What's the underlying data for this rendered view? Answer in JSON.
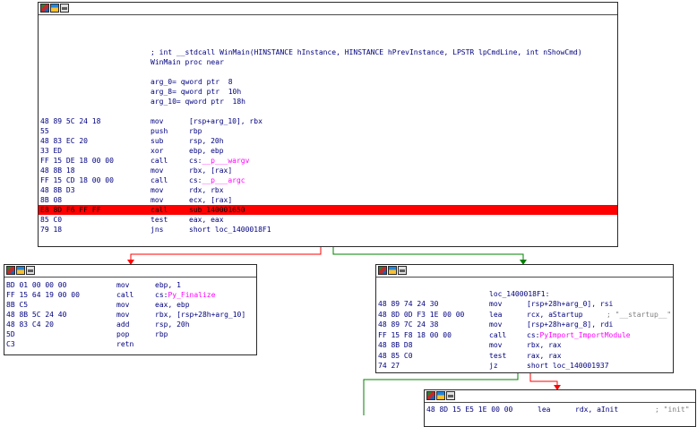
{
  "colors": {
    "text": "#00007f",
    "import_name": "#ff00ff",
    "comment": "#7f7f7f",
    "highlight": "#ff0000",
    "edge_false": "#ff0000",
    "edge_true": "#008000",
    "edge_flow": "#008000"
  },
  "icons": [
    "graph-color-icon",
    "graph-image-icon",
    "graph-window-icon"
  ],
  "nodes": [
    {
      "id": "winmain",
      "header": [
        "; int __stdcall WinMain(HINSTANCE hInstance, HINSTANCE hPrevInstance, LPSTR lpCmdLine, int nShowCmd)",
        "WinMain proc near",
        "",
        "arg_0= qword ptr  8",
        "arg_8= qword ptr  10h",
        "arg_10= qword ptr  18h",
        ""
      ],
      "rows": [
        {
          "bytes": "48 89 5C 24 18",
          "mnem": "mov",
          "ops": "[rsp+arg_10], rbx"
        },
        {
          "bytes": "55",
          "mnem": "push",
          "ops": "rbp"
        },
        {
          "bytes": "48 83 EC 20",
          "mnem": "sub",
          "ops": "rsp, 20h"
        },
        {
          "bytes": "33 ED",
          "mnem": "xor",
          "ops": "ebp, ebp"
        },
        {
          "bytes": "FF 15 DE 18 00 00",
          "mnem": "call",
          "ops": "cs:",
          "imp": "__p___wargv"
        },
        {
          "bytes": "48 8B 18",
          "mnem": "mov",
          "ops": "rbx, [rax]"
        },
        {
          "bytes": "FF 15 CD 18 00 00",
          "mnem": "call",
          "ops": "cs:",
          "imp": "__p___argc"
        },
        {
          "bytes": "48 8B D3",
          "mnem": "mov",
          "ops": "rdx, rbx"
        },
        {
          "bytes": "8B 08",
          "mnem": "mov",
          "ops": "ecx, [rax]"
        },
        {
          "bytes": "E8 8D F6 FF FF",
          "mnem": "call",
          "ops": "sub_140001650",
          "highlight": true
        },
        {
          "bytes": "85 C0",
          "mnem": "test",
          "ops": "eax, eax"
        },
        {
          "bytes": "79 18",
          "mnem": "jns",
          "ops": "short loc_1400018F1"
        }
      ]
    },
    {
      "id": "finalize",
      "header": [],
      "rows": [
        {
          "bytes": "BD 01 00 00 00",
          "mnem": "mov",
          "ops": "ebp, 1"
        },
        {
          "bytes": "FF 15 64 19 00 00",
          "mnem": "call",
          "ops": "cs:",
          "imp": "Py_Finalize"
        },
        {
          "bytes": "8B C5",
          "mnem": "mov",
          "ops": "eax, ebp"
        },
        {
          "bytes": "48 8B 5C 24 40",
          "mnem": "mov",
          "ops": "rbx, [rsp+28h+arg_10]"
        },
        {
          "bytes": "48 83 C4 20",
          "mnem": "add",
          "ops": "rsp, 20h"
        },
        {
          "bytes": "5D",
          "mnem": "pop",
          "ops": "rbp"
        },
        {
          "bytes": "C3",
          "mnem": "retn",
          "ops": ""
        }
      ]
    },
    {
      "id": "loc18f1",
      "header": [
        "",
        "loc_1400018F1:"
      ],
      "rows": [
        {
          "bytes": "48 89 74 24 30",
          "mnem": "mov",
          "ops": "[rsp+28h+arg_0], rsi"
        },
        {
          "bytes": "48 8D 0D F3 1E 00 00",
          "mnem": "lea",
          "ops": "rcx, aStartup",
          "cmt": "; \"__startup__\""
        },
        {
          "bytes": "48 89 7C 24 38",
          "mnem": "mov",
          "ops": "[rsp+28h+arg_8], rdi"
        },
        {
          "bytes": "FF 15 F8 18 00 00",
          "mnem": "call",
          "ops": "cs:",
          "imp": "PyImport_ImportModule"
        },
        {
          "bytes": "48 8B D8",
          "mnem": "mov",
          "ops": "rbx, rax"
        },
        {
          "bytes": "48 85 C0",
          "mnem": "test",
          "ops": "rax, rax"
        },
        {
          "bytes": "74 27",
          "mnem": "jz",
          "ops": "short loc_140001937"
        }
      ]
    },
    {
      "id": "init",
      "header": [],
      "rows": [
        {
          "bytes": "48 8D 15 E5 1E 00 00",
          "mnem": "lea",
          "ops": "rdx, aInit",
          "cmt": "; \"init\""
        }
      ]
    }
  ]
}
